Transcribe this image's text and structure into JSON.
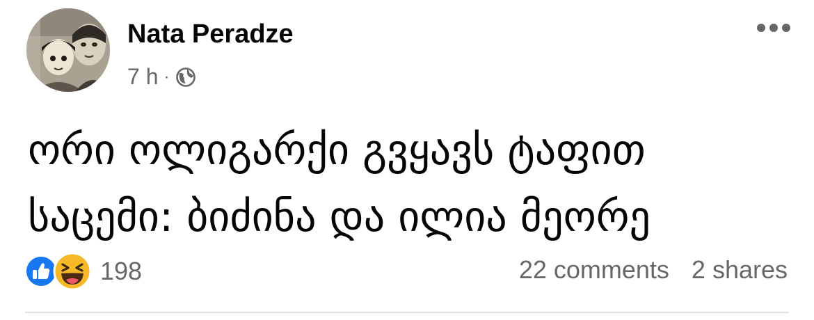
{
  "post": {
    "author": "Nata Peradze",
    "time": "7 h",
    "separator": "·",
    "audience_icon": "globe-icon",
    "text": "ორი ოლიგარქი გვყავს ტაფით\nსაცემი: ბიძინა და ილია მეორე"
  },
  "reactions": {
    "icons": [
      "like-icon",
      "haha-icon"
    ],
    "count": "198"
  },
  "stats": {
    "comments": "22 comments",
    "shares": "2 shares"
  },
  "colors": {
    "text": "#050505",
    "secondary": "#65676b",
    "like_blue": "#1877f2",
    "haha_yellow": "#f7b928",
    "divider": "#dcdfe4"
  }
}
